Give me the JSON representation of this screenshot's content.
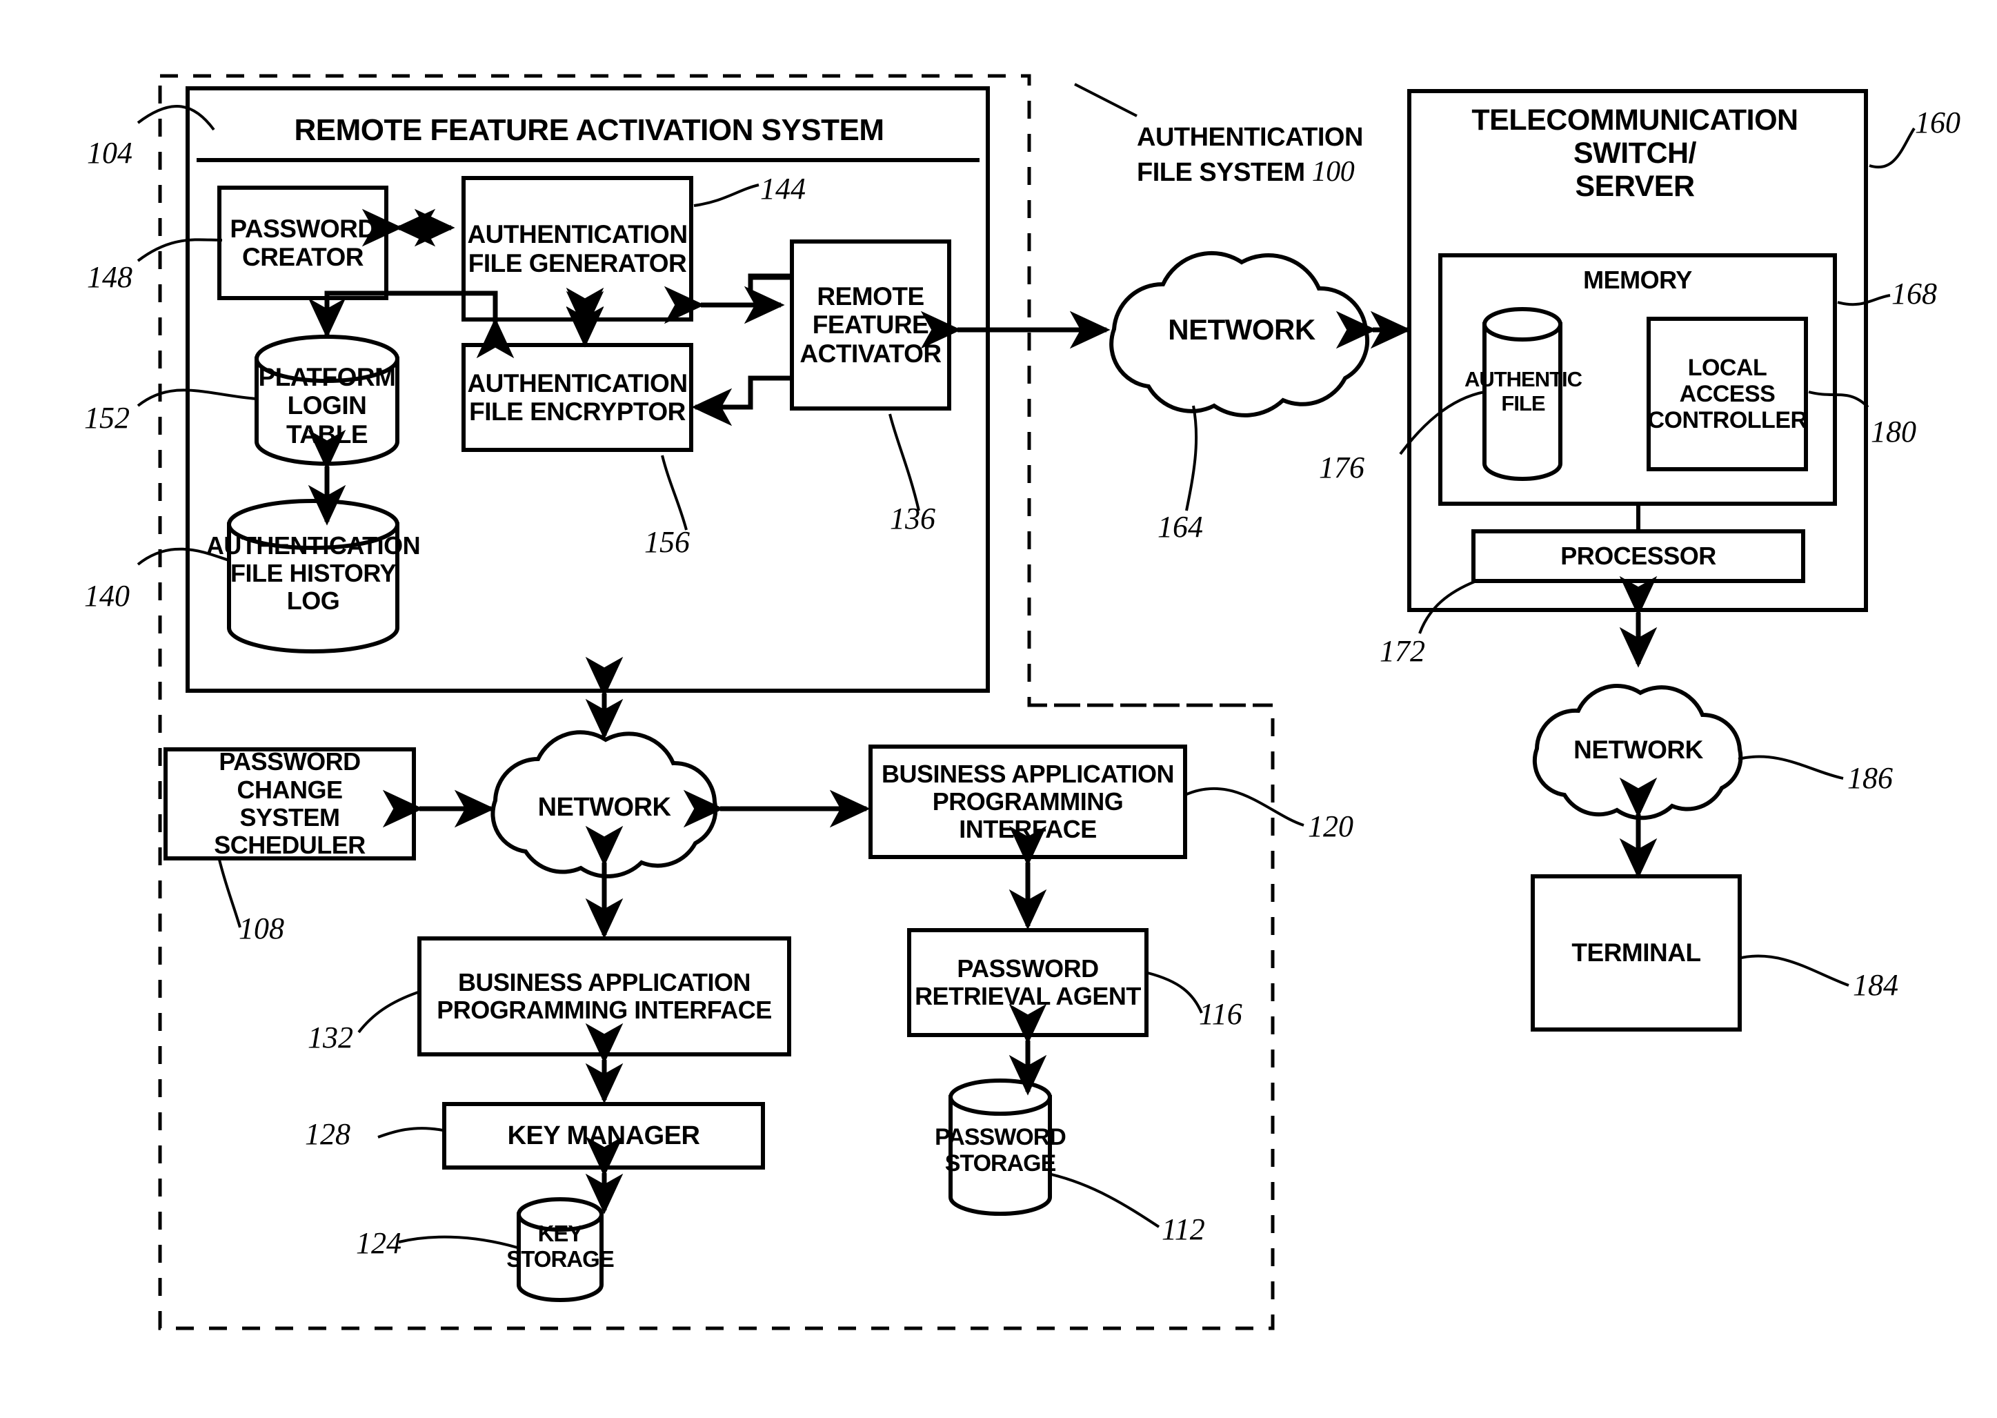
{
  "figure": {
    "title": "AUTHENTICATION FILE SYSTEM",
    "title_ref": "100"
  },
  "containers": {
    "authentication_file_system_label": "AUTHENTICATION\nFILE SYSTEM ",
    "authentication_file_system_ref": "100",
    "remote_feature_activation_system": "REMOTE FEATURE ACTIVATION SYSTEM",
    "remote_feature_activation_system_ref": "104",
    "telecommunication_switch_server": "TELECOMMUNICATION SWITCH/\nSERVER",
    "telecommunication_switch_server_ref": "160",
    "memory": "MEMORY",
    "memory_ref": "168"
  },
  "blocks": {
    "password_creator": {
      "label": "PASSWORD\nCREATOR",
      "ref": "148"
    },
    "authentication_file_generator": {
      "label": "AUTHENTICATION\nFILE GENERATOR",
      "ref": "144"
    },
    "remote_feature_activator": {
      "label": "REMOTE\nFEATURE\nACTIVATOR",
      "ref": "136"
    },
    "platform_login_table": {
      "label": "PLATFORM\nLOGIN TABLE",
      "ref": "152"
    },
    "authentication_file_encryptor": {
      "label": "AUTHENTICATION\nFILE ENCRYPTOR",
      "ref": "156"
    },
    "authentication_file_history_log": {
      "label": "AUTHENTICATION\nFILE HISTORY LOG",
      "ref": "140"
    },
    "network_top": {
      "label": "NETWORK",
      "ref": "164"
    },
    "authentic_file": {
      "label": "AUTHENTIC\nFILE",
      "ref": "176"
    },
    "local_access_controller": {
      "label": "LOCAL\nACCESS\nCONTROLLER",
      "ref": "180"
    },
    "processor": {
      "label": "PROCESSOR",
      "ref": "172"
    },
    "network_right": {
      "label": "NETWORK",
      "ref": "186"
    },
    "terminal": {
      "label": "TERMINAL",
      "ref": "184"
    },
    "password_change_system_scheduler": {
      "label": "PASSWORD CHANGE\nSYSTEM SCHEDULER",
      "ref": "108"
    },
    "network_bottom": {
      "label": "NETWORK",
      "ref": ""
    },
    "business_api_right": {
      "label": "BUSINESS APPLICATION\nPROGRAMMING INTERFACE",
      "ref": "120"
    },
    "business_api_center": {
      "label": "BUSINESS APPLICATION\nPROGRAMMING INTERFACE",
      "ref": "132"
    },
    "password_retrieval_agent": {
      "label": "PASSWORD\nRETRIEVAL AGENT",
      "ref": "116"
    },
    "key_manager": {
      "label": "KEY MANAGER",
      "ref": "128"
    },
    "key_storage": {
      "label": "KEY STORAGE",
      "ref": "124"
    },
    "password_storage": {
      "label": "PASSWORD\nSTORAGE",
      "ref": "112"
    }
  },
  "colors": {
    "line": "#000000",
    "background": "#ffffff"
  }
}
